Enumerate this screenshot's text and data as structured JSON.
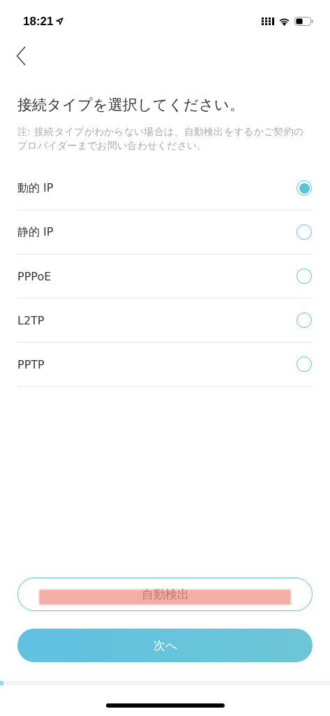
{
  "status_bar": {
    "time": "18:21"
  },
  "title": "接続タイプを選択してください。",
  "note": "注: 接続タイプがわからない場合は、自動検出をするかご契約のプロバイダーまでお問い合わせください。",
  "options": [
    {
      "label": "動的 IP",
      "selected": true
    },
    {
      "label": "静的 IP",
      "selected": false
    },
    {
      "label": "PPPoE",
      "selected": false
    },
    {
      "label": "L2TP",
      "selected": false
    },
    {
      "label": "PPTP",
      "selected": false
    }
  ],
  "auto_detect_button": {
    "label": "自動検出",
    "highlighted": true
  },
  "next_button": {
    "label": "次へ"
  },
  "progress": {
    "level": 0.01
  }
}
